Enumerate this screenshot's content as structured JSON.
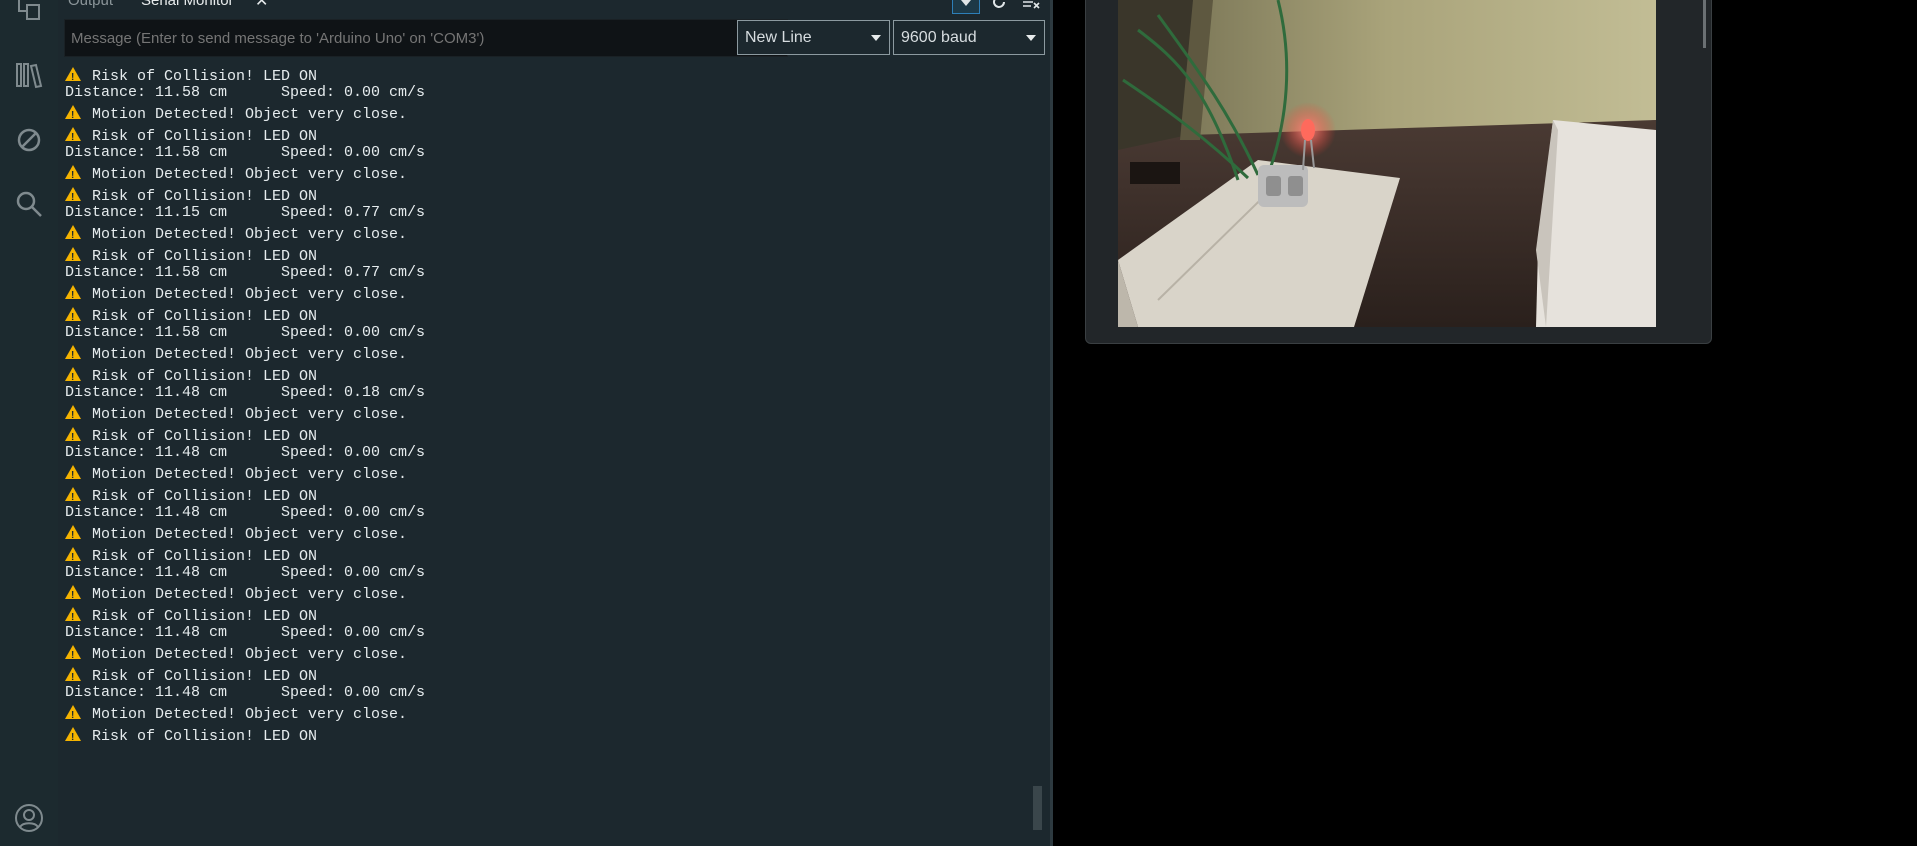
{
  "tabs": {
    "output_label": "Output",
    "serial_label": "Serial Monitor",
    "close_glyph": "✕"
  },
  "toolbar": {
    "collapse_icon": "chevron-down-icon",
    "toggle_icon": "autoscroll-icon",
    "clear_icon": "clear-output-icon"
  },
  "input": {
    "placeholder": "Message (Enter to send message to 'Arduino Uno' on 'COM3')"
  },
  "line_ending": {
    "selected": "New Line"
  },
  "baud_rate": {
    "selected": "9600 baud"
  },
  "log": [
    {
      "kind": "warn",
      "text": "Risk of Collision! LED ON"
    },
    {
      "kind": "plain",
      "text": "Distance: 11.58 cm      Speed: 0.00 cm/s"
    },
    {
      "kind": "warn",
      "text": "Motion Detected! Object very close."
    },
    {
      "kind": "warn",
      "text": "Risk of Collision! LED ON"
    },
    {
      "kind": "plain",
      "text": "Distance: 11.58 cm      Speed: 0.00 cm/s"
    },
    {
      "kind": "warn",
      "text": "Motion Detected! Object very close."
    },
    {
      "kind": "warn",
      "text": "Risk of Collision! LED ON"
    },
    {
      "kind": "plain",
      "text": "Distance: 11.15 cm      Speed: 0.77 cm/s"
    },
    {
      "kind": "warn",
      "text": "Motion Detected! Object very close."
    },
    {
      "kind": "warn",
      "text": "Risk of Collision! LED ON"
    },
    {
      "kind": "plain",
      "text": "Distance: 11.58 cm      Speed: 0.77 cm/s"
    },
    {
      "kind": "warn",
      "text": "Motion Detected! Object very close."
    },
    {
      "kind": "warn",
      "text": "Risk of Collision! LED ON"
    },
    {
      "kind": "plain",
      "text": "Distance: 11.58 cm      Speed: 0.00 cm/s"
    },
    {
      "kind": "warn",
      "text": "Motion Detected! Object very close."
    },
    {
      "kind": "warn",
      "text": "Risk of Collision! LED ON"
    },
    {
      "kind": "plain",
      "text": "Distance: 11.48 cm      Speed: 0.18 cm/s"
    },
    {
      "kind": "warn",
      "text": "Motion Detected! Object very close."
    },
    {
      "kind": "warn",
      "text": "Risk of Collision! LED ON"
    },
    {
      "kind": "plain",
      "text": "Distance: 11.48 cm      Speed: 0.00 cm/s"
    },
    {
      "kind": "warn",
      "text": "Motion Detected! Object very close."
    },
    {
      "kind": "warn",
      "text": "Risk of Collision! LED ON"
    },
    {
      "kind": "plain",
      "text": "Distance: 11.48 cm      Speed: 0.00 cm/s"
    },
    {
      "kind": "warn",
      "text": "Motion Detected! Object very close."
    },
    {
      "kind": "warn",
      "text": "Risk of Collision! LED ON"
    },
    {
      "kind": "plain",
      "text": "Distance: 11.48 cm      Speed: 0.00 cm/s"
    },
    {
      "kind": "warn",
      "text": "Motion Detected! Object very close."
    },
    {
      "kind": "warn",
      "text": "Risk of Collision! LED ON"
    },
    {
      "kind": "plain",
      "text": "Distance: 11.48 cm      Speed: 0.00 cm/s"
    },
    {
      "kind": "warn",
      "text": "Motion Detected! Object very close."
    },
    {
      "kind": "warn",
      "text": "Risk of Collision! LED ON"
    },
    {
      "kind": "plain",
      "text": "Distance: 11.48 cm      Speed: 0.00 cm/s"
    },
    {
      "kind": "warn",
      "text": "Motion Detected! Object very close."
    },
    {
      "kind": "warn",
      "text": "Risk of Collision! LED ON"
    }
  ],
  "activity_bar": {
    "icons": [
      "sketchbook-icon",
      "library-manager-icon",
      "debug-icon",
      "search-icon",
      "account-icon"
    ]
  },
  "colors": {
    "panel_bg": "#1c282e",
    "warning": "#f5b400",
    "led_red": "#ff3b30"
  }
}
